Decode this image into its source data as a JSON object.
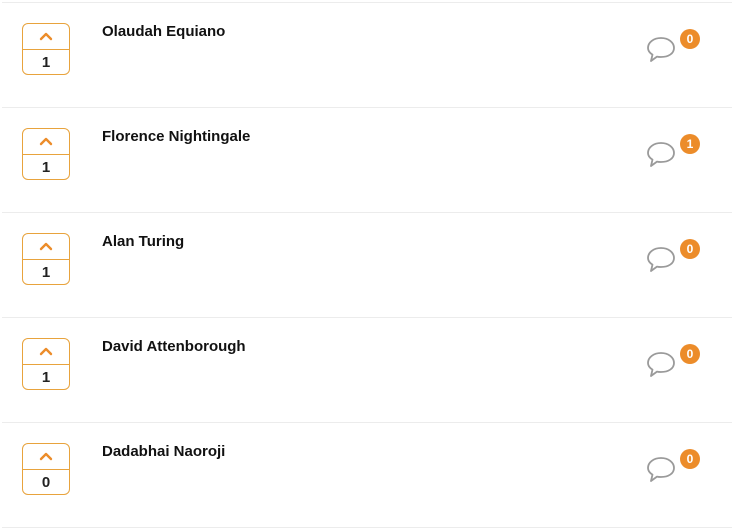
{
  "colors": {
    "accent": "#ec8c2a",
    "vote_border": "#e8a33d",
    "divider": "#ececec"
  },
  "icons": {
    "upvote": "chevron-up-icon",
    "comments": "speech-bubble-icon"
  },
  "items": [
    {
      "title": "Olaudah Equiano",
      "votes": "1",
      "comments": "0"
    },
    {
      "title": "Florence Nightingale",
      "votes": "1",
      "comments": "1"
    },
    {
      "title": "Alan Turing",
      "votes": "1",
      "comments": "0"
    },
    {
      "title": "David Attenborough",
      "votes": "1",
      "comments": "0"
    },
    {
      "title": "Dadabhai Naoroji",
      "votes": "0",
      "comments": "0"
    }
  ]
}
